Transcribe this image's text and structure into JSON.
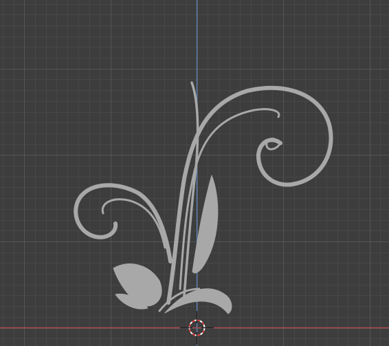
{
  "viewport": {
    "background_color": "#3d3d3d",
    "grid_minor_color": "#474747",
    "grid_major_color": "#555555",
    "axis_x_color": "#b84a52",
    "axis_y_color": "#5a7fb4",
    "object_color": "#a8a8a8",
    "cursor_ring_colors": [
      "#ffffff",
      "#e04040"
    ],
    "cursor_cross_color": "#202020",
    "object_name": "flourish-curve",
    "cursor_name": "3d-cursor"
  }
}
